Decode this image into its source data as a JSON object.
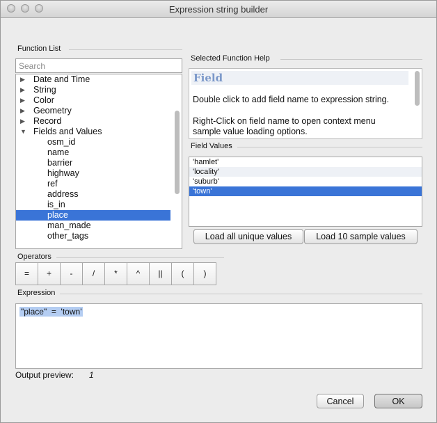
{
  "window": {
    "title": "Expression string builder"
  },
  "function_list": {
    "section_label": "Function List",
    "search_placeholder": "Search",
    "items": [
      {
        "label": "Date and Time",
        "type": "group",
        "arrow": "▶"
      },
      {
        "label": "String",
        "type": "group",
        "arrow": "▶"
      },
      {
        "label": "Color",
        "type": "group",
        "arrow": "▶"
      },
      {
        "label": "Geometry",
        "type": "group",
        "arrow": "▶"
      },
      {
        "label": "Record",
        "type": "group",
        "arrow": "▶"
      },
      {
        "label": "Fields and Values",
        "type": "group",
        "arrow": "▼"
      },
      {
        "label": "osm_id",
        "type": "child"
      },
      {
        "label": "name",
        "type": "child"
      },
      {
        "label": "barrier",
        "type": "child"
      },
      {
        "label": "highway",
        "type": "child"
      },
      {
        "label": "ref",
        "type": "child"
      },
      {
        "label": "address",
        "type": "child"
      },
      {
        "label": "is_in",
        "type": "child"
      },
      {
        "label": "place",
        "type": "child",
        "selected": true
      },
      {
        "label": "man_made",
        "type": "child"
      },
      {
        "label": "other_tags",
        "type": "child"
      }
    ]
  },
  "help": {
    "section_label": "Selected Function Help",
    "heading": "Field",
    "line1": "Double click to add field name to expression string.",
    "line2": "Right-Click on field name to open context menu",
    "line3": "sample value loading options."
  },
  "field_values": {
    "section_label": "Field Values",
    "items": [
      "'hamlet'",
      "'locality'",
      "'suburb'",
      "'town'"
    ],
    "selected_index": 3,
    "load_all_label": "Load all unique values",
    "load_sample_label": "Load 10 sample values"
  },
  "operators": {
    "section_label": "Operators",
    "items": [
      {
        "symbol": "=",
        "name": "equals"
      },
      {
        "symbol": "+",
        "name": "plus"
      },
      {
        "symbol": "-",
        "name": "minus"
      },
      {
        "symbol": "/",
        "name": "divide"
      },
      {
        "symbol": "*",
        "name": "multiply"
      },
      {
        "symbol": "^",
        "name": "power"
      },
      {
        "symbol": "||",
        "name": "concat"
      },
      {
        "symbol": "(",
        "name": "open-paren"
      },
      {
        "symbol": ")",
        "name": "close-paren"
      }
    ]
  },
  "expression": {
    "section_label": "Expression",
    "value": "\"place\"  =  'town'",
    "output_label": "Output preview:",
    "output_value": "1"
  },
  "buttons": {
    "cancel": "Cancel",
    "ok": "OK"
  },
  "colors": {
    "selection": "#3a74d7",
    "expression_highlight": "#b4cdf2",
    "help_heading": "#7b98c9"
  }
}
